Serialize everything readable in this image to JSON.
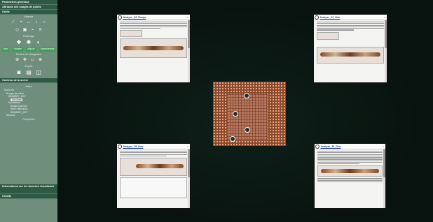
{
  "sidebar": {
    "bands_top": [
      "Paramètres généraux",
      "Attributs des nuages de points",
      "Outils"
    ],
    "sections": {
      "mesure": "Mesure",
      "ecclairage": "Éclairage",
      "mode_nav": "Modes de Navigation",
      "export": "Export",
      "arbre": "Arbre",
      "proprietes": "Propriétés"
    },
    "buttons": [
      "Nord",
      "Scalaire",
      "Altitude",
      "Gras/Intensité"
    ],
    "content_band": "Contenu de la scène",
    "tree": [
      "Scene 3D",
      "Nuages de points",
      "BRAMBRY_1317",
      "Vue Nord",
      "Annotations",
      "Nuage ScanGrid",
      "Mesh Fabrication",
      "BRAMBRY_1317",
      "Mesures"
    ],
    "bands_bottom": [
      "Informations sur les données visualisées",
      "Crédits"
    ]
  },
  "panels": [
    {
      "title": "Analyse_33_Rouge"
    },
    {
      "title": "Analyse_33_Noir"
    },
    {
      "title": "Analyse_35_Noir"
    },
    {
      "title": "Analyse_35_Gris"
    }
  ]
}
